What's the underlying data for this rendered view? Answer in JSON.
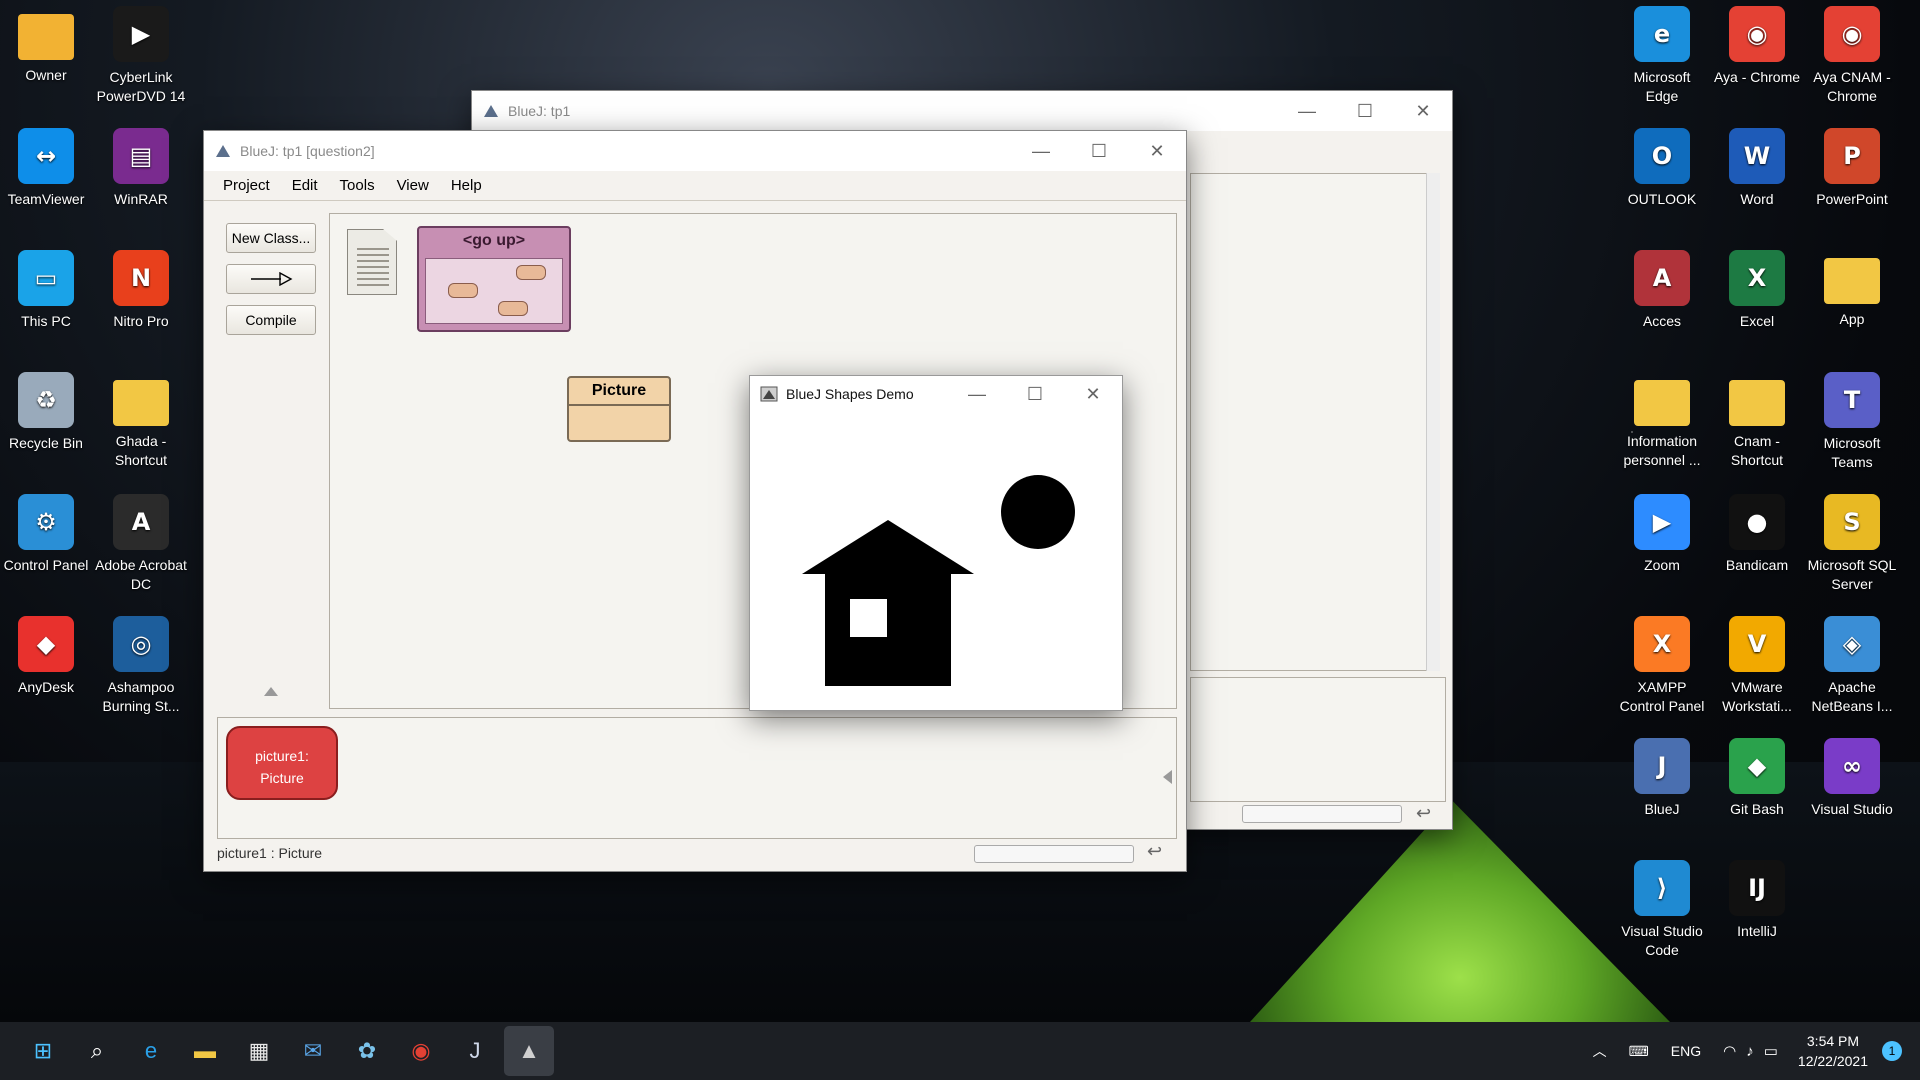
{
  "desktop": {
    "left_icons": [
      {
        "label": "Owner",
        "name": "folder-icon",
        "color": "#f2b233"
      },
      {
        "label": "CyberLink PowerDVD 14",
        "name": "powerdvd-icon",
        "color": "#1a1a1a"
      },
      {
        "label": "TeamViewer",
        "name": "teamviewer-icon",
        "color": "#0e8ee9"
      },
      {
        "label": "WinRAR",
        "name": "winrar-icon",
        "color": "#7a2b8f"
      },
      {
        "label": "This PC",
        "name": "monitor-icon",
        "color": "#1aa3e8"
      },
      {
        "label": "Nitro Pro",
        "name": "nitro-icon",
        "color": "#e8401c"
      },
      {
        "label": "Recycle Bin",
        "name": "recycle-bin-icon",
        "color": "#9ab"
      },
      {
        "label": "Ghada - Shortcut",
        "name": "folder-icon",
        "color": "#f2c744"
      },
      {
        "label": "Control Panel",
        "name": "control-panel-icon",
        "color": "#2a8fd6"
      },
      {
        "label": "Adobe Acrobat DC",
        "name": "acrobat-icon",
        "color": "#2b2b2b"
      },
      {
        "label": "AnyDesk",
        "name": "anydesk-icon",
        "color": "#e8312d"
      },
      {
        "label": "Ashampoo Burning St...",
        "name": "ashampoo-icon",
        "color": "#1d5e9c"
      }
    ],
    "right_icons": [
      {
        "label": "Microsoft Edge",
        "name": "edge-icon",
        "color": "#1a8fdc"
      },
      {
        "label": "Aya - Chrome",
        "name": "chrome-icon",
        "color": "#e44134"
      },
      {
        "label": "Aya CNAM - Chrome",
        "name": "chrome-icon",
        "color": "#e44134"
      },
      {
        "label": "OUTLOOK",
        "name": "outlook-icon",
        "color": "#0f6cbd"
      },
      {
        "label": "Word",
        "name": "word-icon",
        "color": "#1e5bb8"
      },
      {
        "label": "PowerPoint",
        "name": "powerpoint-icon",
        "color": "#d0472a"
      },
      {
        "label": "Acces",
        "name": "access-icon",
        "color": "#b0333a"
      },
      {
        "label": "Excel",
        "name": "excel-icon",
        "color": "#1d7a43"
      },
      {
        "label": "App",
        "name": "folder-icon",
        "color": "#f2c744"
      },
      {
        "label": "Information personnel ...",
        "name": "folder-icon",
        "color": "#f2c744"
      },
      {
        "label": "Cnam - Shortcut",
        "name": "folder-icon",
        "color": "#f2c744"
      },
      {
        "label": "Microsoft Teams",
        "name": "teams-icon",
        "color": "#5a5fc7"
      },
      {
        "label": "Zoom",
        "name": "zoom-icon",
        "color": "#2d8cff"
      },
      {
        "label": "Bandicam",
        "name": "bandicam-icon",
        "color": "#111"
      },
      {
        "label": "Microsoft SQL Server",
        "name": "sql-server-icon",
        "color": "#e8b923"
      },
      {
        "label": "XAMPP Control Panel",
        "name": "xampp-icon",
        "color": "#fb7a24"
      },
      {
        "label": "VMware Workstati...",
        "name": "vmware-icon",
        "color": "#f2a900"
      },
      {
        "label": "Apache NetBeans I...",
        "name": "netbeans-icon",
        "color": "#3a8ed6"
      },
      {
        "label": "BlueJ",
        "name": "bluej-icon",
        "color": "#4a6fb0"
      },
      {
        "label": "Git Bash",
        "name": "git-bash-icon",
        "color": "#2aa24c"
      },
      {
        "label": "Visual Studio",
        "name": "visual-studio-icon",
        "color": "#7a3cc8"
      },
      {
        "label": "Visual Studio Code",
        "name": "vscode-icon",
        "color": "#1f8ad2"
      },
      {
        "label": "IntelliJ",
        "name": "intellij-icon",
        "color": "#111"
      }
    ]
  },
  "back_window": {
    "title": "BlueJ:  tp1"
  },
  "main_window": {
    "title": "BlueJ:  tp1  [question2]",
    "menu": [
      "Project",
      "Edit",
      "Tools",
      "View",
      "Help"
    ],
    "buttons": {
      "new_class": "New Class...",
      "compile": "Compile"
    },
    "package_label": "<go up>",
    "class_name": "Picture",
    "object_label_1": "picture1:",
    "object_label_2": "Picture",
    "status": "picture1 : Picture"
  },
  "shapes_window": {
    "title": "BlueJ Shapes Demo",
    "shapes": [
      "house-roof",
      "house-body",
      "house-window",
      "sun"
    ]
  },
  "taskbar": {
    "items": [
      "start-icon",
      "search-icon",
      "edge-icon",
      "file-explorer-icon",
      "store-icon",
      "mail-icon",
      "paint-icon",
      "chrome-icon",
      "bluej-icon",
      "shapes-demo-icon"
    ],
    "language": "ENG",
    "time": "3:54 PM",
    "date": "12/22/2021",
    "notification_count": "1"
  }
}
